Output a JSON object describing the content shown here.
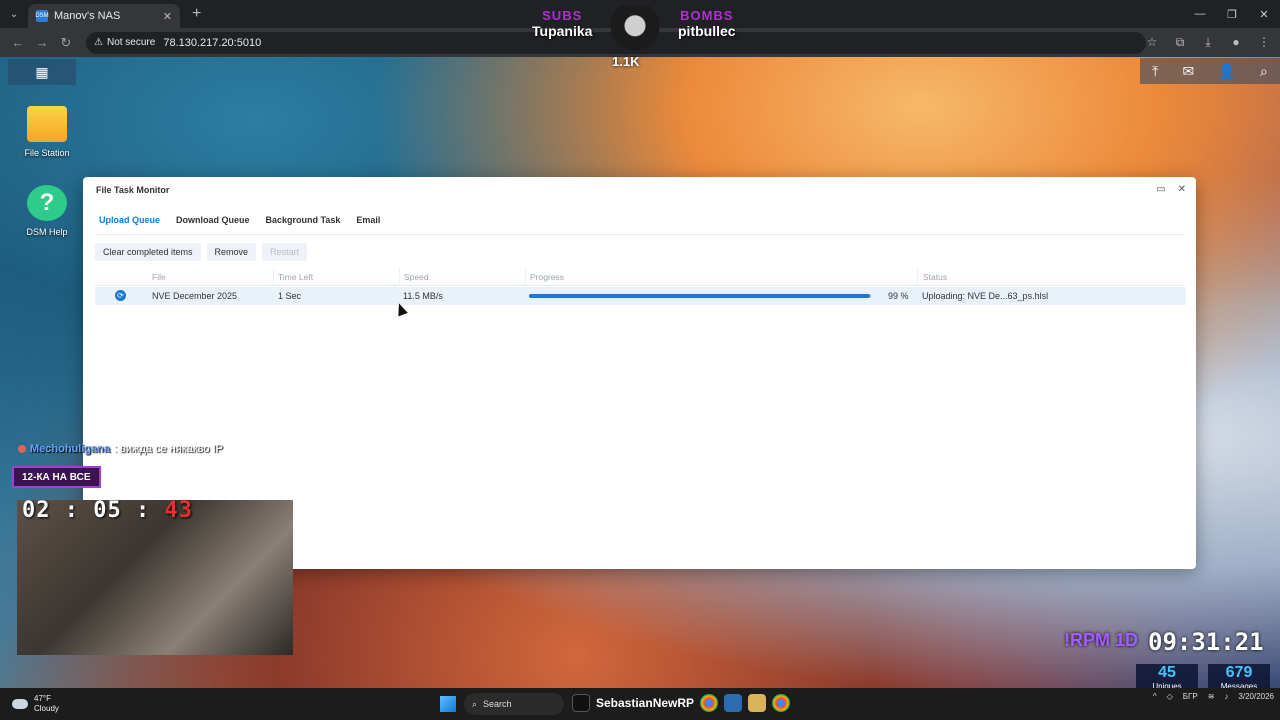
{
  "browser": {
    "tab_title": "Manov's NAS",
    "tab_favicon_text": "DSM",
    "not_secure_label": "Not secure",
    "url": "78.130.217.20:5010"
  },
  "overlay": {
    "subs_label": "SUBS",
    "subs_name": "Tupanika",
    "bombs_label": "BOMBS",
    "bombs_name": "pitbullec",
    "count": "1.1K"
  },
  "desktop": {
    "icons": [
      {
        "label": "File Station"
      },
      {
        "label": "DSM Help"
      }
    ]
  },
  "window": {
    "title": "File Task Monitor",
    "tabs": [
      "Upload Queue",
      "Download Queue",
      "Background Task",
      "Email"
    ],
    "active_tab": "Upload Queue",
    "toolbar": {
      "clear_label": "Clear completed items",
      "remove_label": "Remove",
      "restart_label": "Restart"
    },
    "columns": [
      "File",
      "Time Left",
      "Speed",
      "Progress",
      "Status"
    ],
    "rows": [
      {
        "file": "NVE December 2025",
        "time_left": "1 Sec",
        "speed": "11.5 MB/s",
        "progress_text": "99 %",
        "progress": 99,
        "status": "Uploading: NVE De...63_ps.hlsl"
      }
    ]
  },
  "stream": {
    "chat_user": "Mechohuligana",
    "chat_msg": ": вижда се някакво IP",
    "banner": "12-КА НА ВСЕ",
    "timer_h": "02",
    "timer_m": "05",
    "timer_s": "43",
    "rpm_label": "!RPM 1D",
    "clock": "09:31:21",
    "uniques_num": "45",
    "uniques_label": "Uniques",
    "messages_num": "679",
    "messages_label": "Messages"
  },
  "taskbar": {
    "temp": "47°F",
    "weather": "Cloudy",
    "search": "Search",
    "app_text": "SebastianNewRP",
    "lang": "БГР",
    "date": "3/20/2026"
  },
  "colors": {
    "accent": "#057fe6",
    "progress": "#1e78d3",
    "row_selected": "#e9f2fb"
  }
}
